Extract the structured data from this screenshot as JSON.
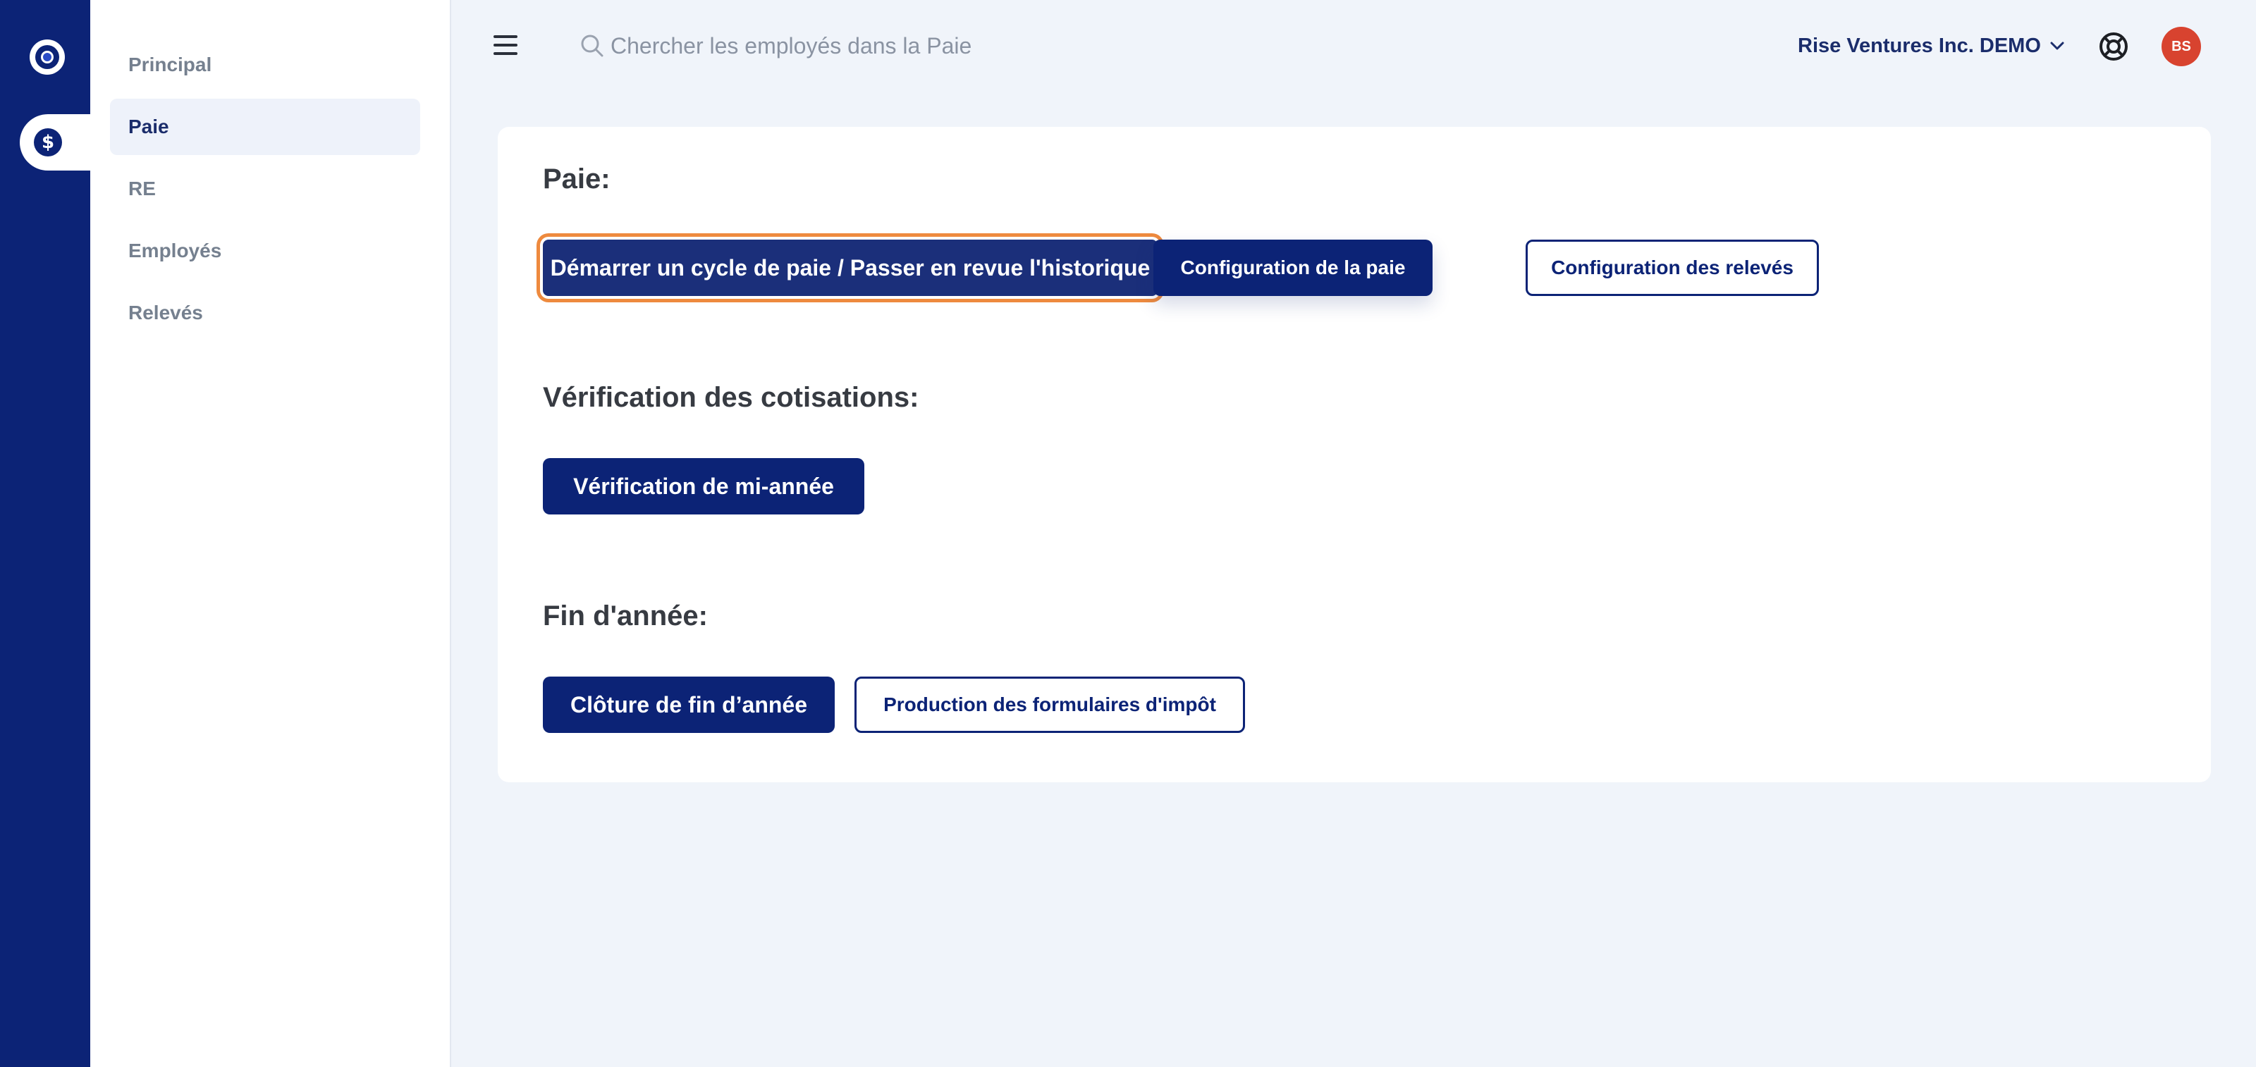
{
  "sidebar": {
    "items": [
      {
        "label": "Principal",
        "active": false
      },
      {
        "label": "Paie",
        "active": true
      },
      {
        "label": "RE",
        "active": false
      },
      {
        "label": "Employés",
        "active": false
      },
      {
        "label": "Relevés",
        "active": false
      }
    ]
  },
  "header": {
    "search_placeholder": "Chercher les employés dans la Paie",
    "company": "Rise Ventures Inc. DEMO",
    "avatar_initials": "BS"
  },
  "sections": {
    "payroll": {
      "title": "Paie:",
      "start_cycle": "Démarrer un cycle de paie / Passer en revue l'historique",
      "payroll_config": "Configuration de la paie",
      "statements_config": "Configuration des relevés"
    },
    "contributions": {
      "title": "Vérification des cotisations:",
      "mid_year": "Vérification de mi-année"
    },
    "year_end": {
      "title": "Fin d'année:",
      "closing": "Clôture de fin d’année",
      "tax_forms": "Production des formulaires d'impôt"
    }
  },
  "colors": {
    "brand": "#0c2376",
    "focus": "#ee8a3e",
    "avatar": "#d8432f"
  },
  "icons": [
    "logo-icon",
    "dollar-icon",
    "menu-icon",
    "search-icon",
    "chevron-down-icon",
    "help-icon"
  ]
}
